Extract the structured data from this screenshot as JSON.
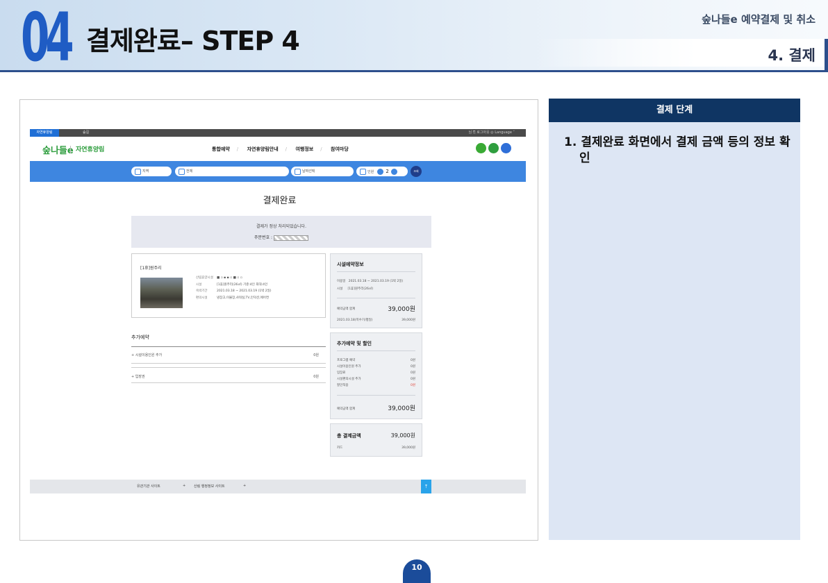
{
  "header": {
    "chapter_number": "04",
    "title": "결제완료– STEP 4",
    "subtitle": "숲나들e 예약결제 및 취소",
    "section": "4. 결제"
  },
  "screenshot": {
    "topbar": {
      "active_tab": "자연휴양림",
      "second_tab": "숲길",
      "right_text": "님  ⎘ 로그아웃  ◎ Language ˅"
    },
    "logo": {
      "brand": "숲나들e",
      "name": "자연휴양림"
    },
    "nav": [
      "통합예약",
      "자연휴양림안내",
      "여행정보",
      "참여마당"
    ],
    "search": {
      "region": "지역",
      "facility": "전체",
      "date": "날짜선택",
      "people_label": "인원",
      "people_count": "2",
      "submit": "조회"
    },
    "page_title": "결제완료",
    "done_box": {
      "message": "결제가 정상 처리되었습니다.",
      "order_label": "주문번호 :"
    },
    "facility_card": {
      "name": "[1휴]원주리",
      "rows": [
        {
          "k": "산림휴양시설",
          "v": "■ ▫ ▪  ▪ ▫ ■ ▫ ▫"
        },
        {
          "k": "시설",
          "v": "[1휴]원주리(26㎡) 기준:4인 최대:4인"
        },
        {
          "k": "숙박기간",
          "v": "2021.03.18 ~ 2021.03.19 (1박 2일)"
        },
        {
          "k": "편의시설",
          "v": "냉장고,이불장,샤워실,TV,인덕션,에어컨"
        }
      ]
    },
    "extra": {
      "title": "추가예약",
      "items": [
        {
          "label": "+   시설이용인원 추가",
          "amount": "0원"
        },
        {
          "label": "+   입장권",
          "amount": "0원"
        }
      ]
    },
    "panel_facility": {
      "title": "시설예약정보",
      "use_date_label": "이용일",
      "use_date": "2021.03.18 ~ 2021.03.19 (1박 2일)",
      "facility_label": "시설",
      "facility": "[1휴]원주리(26㎡)",
      "sum_label": "예약금액 합계",
      "sum": "39,000원",
      "detail_label": "2021.03.18(목수기/평일)",
      "detail": "39,000원"
    },
    "panel_discount": {
      "title": "추가예약 및 할인",
      "rows": [
        {
          "k": "프로그램 예약",
          "v": "0원"
        },
        {
          "k": "시설이용인원 추가",
          "v": "0원"
        },
        {
          "k": "입장료",
          "v": "0원"
        },
        {
          "k": "시설편의시설 추가",
          "v": "0원"
        },
        {
          "k": "할인적용",
          "v": "0원"
        }
      ],
      "sum_label": "예약금액 합계",
      "sum": "39,000원"
    },
    "panel_total": {
      "title": "총 결제금액",
      "total": "39,000원",
      "method_label": "카드",
      "method_amount": "39,000원"
    },
    "footer": {
      "link1": "유관기관 사이트",
      "link2": "산림 행정정보 사이트",
      "top_button": "⤒"
    }
  },
  "side": {
    "heading": "결제 단계",
    "step": "1. 결제완료 화면에서 결제 금액 등의 정보 확인"
  },
  "page_number": "10",
  "colors": {
    "accent_blue": "#1f5cc4",
    "navy": "#0f3563",
    "site_blue": "#3e86e0",
    "green": "#2f9e3f"
  }
}
